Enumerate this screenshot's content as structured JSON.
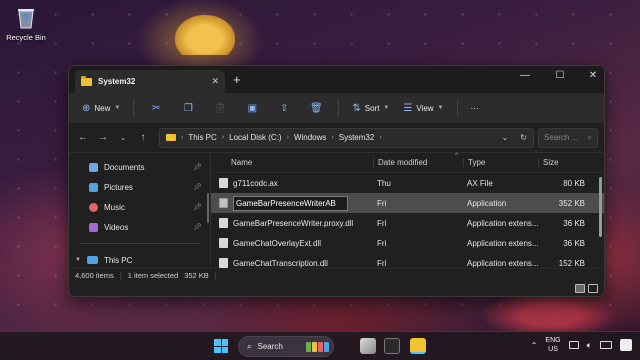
{
  "desktop": {
    "recycle_bin_label": "Recycle Bin"
  },
  "window": {
    "tab_title": "System32",
    "controls": {
      "minimize": "—",
      "maximize": "☐",
      "close": "✕"
    }
  },
  "commandbar": {
    "new_label": "New",
    "sort_label": "Sort",
    "view_label": "View",
    "more_label": "···"
  },
  "address": {
    "crumbs": [
      "This PC",
      "Local Disk (C:)",
      "Windows",
      "System32"
    ],
    "search_placeholder": "Search ..."
  },
  "nav": {
    "items": [
      {
        "label": "Documents",
        "color": "#6fa8dc"
      },
      {
        "label": "Pictures",
        "color": "#4fa3e0"
      },
      {
        "label": "Music",
        "color": "#e06666"
      },
      {
        "label": "Videos",
        "color": "#a569d6"
      }
    ],
    "this_pc": "This PC"
  },
  "table": {
    "headers": {
      "name": "Name",
      "date": "Date modified",
      "type": "Type",
      "size": "Size"
    },
    "rows": [
      {
        "name": "g711codc.ax",
        "date": "Thu",
        "type": "AX File",
        "size": "80 KB"
      },
      {
        "name": "GameBarPresenceWriter",
        "rename_value": "GameBarPresenceWriterAB",
        "date": "Fri",
        "type": "Application",
        "size": "352 KB",
        "selected": true
      },
      {
        "name": "GameBarPresenceWriter.proxy.dll",
        "date": "Fri",
        "type": "Application extens...",
        "size": "36 KB"
      },
      {
        "name": "GameChatOverlayExt.dll",
        "date": "Fri",
        "type": "Application extens...",
        "size": "36 KB"
      },
      {
        "name": "GameChatTranscription.dll",
        "date": "Fri",
        "type": "Application extens...",
        "size": "152 KB"
      }
    ]
  },
  "status": {
    "count": "4,600 items",
    "selected": "1 item selected",
    "size": "352 KB"
  },
  "taskbar": {
    "search_label": "Search",
    "lang_line1": "ENG",
    "lang_line2": "US"
  },
  "colors": {
    "accent": "#4cc2ff",
    "folder": "#f1c232"
  }
}
